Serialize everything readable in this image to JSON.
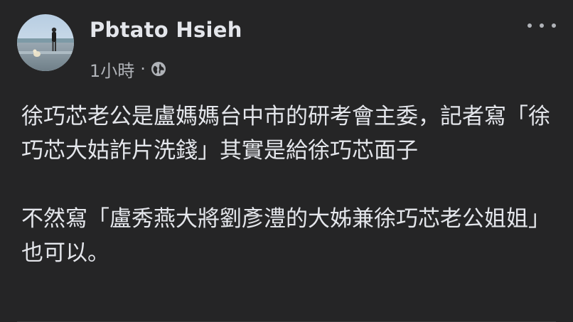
{
  "post": {
    "author": "Pbtato Hsieh",
    "time": "1小時",
    "separator": "·",
    "privacy_icon": "globe-icon",
    "more_icon": "more-options-icon",
    "paragraphs": [
      "徐巧芯老公是盧媽媽台中市的研考會主委，記者寫「徐巧芯大姑詐片洗錢」其實是給徐巧芯面子",
      "不然寫「盧秀燕大將劉彥澧的大姊兼徐巧芯老公姐姐」也可以。"
    ]
  },
  "colors": {
    "background": "#252526",
    "primary_text": "#e4e6eb",
    "secondary_text": "#b0b3b8"
  }
}
